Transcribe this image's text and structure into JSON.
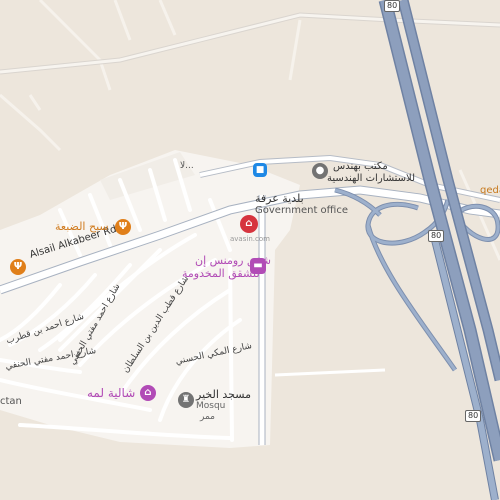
{
  "roads": {
    "alsail": "Alsail Alkabeer Rd",
    "street_1": "شارع احمد بن قطرب",
    "street_2": "شارع احمد مفتي الحنفي",
    "street_3": "شارع احمد مفتي الحنفي",
    "street_4": "شارع المكي الحسني",
    "street_5": "شارع قطب الدين بن السلطان",
    "street_top": "لا...",
    "left_edge": "ctan",
    "qeda": "qeda",
    "shield_80_a": "80",
    "shield_80_b": "80",
    "shield_80_c": "80",
    "ghost_label": "avasin.com"
  },
  "pois": {
    "sabaa": {
      "name": "سبح الضبعة",
      "icon": "restaurant-icon"
    },
    "left_food": {
      "icon": "restaurant-icon"
    },
    "office": {
      "name_ar": "مكتب بهندس",
      "name_ar2": "للاستشارات الهندسية",
      "icon": "place-icon"
    },
    "municipality": {
      "name_ar": "بلدية عرفة",
      "name_en": "Government office",
      "icon": "government-icon"
    },
    "rooms": {
      "name_ar": "شقق رومنس إن",
      "name_ar2": "للشقق المخدومة",
      "icon": "hotel-icon"
    },
    "shalia": {
      "name": "شالية لمه",
      "icon": "shopping-icon"
    },
    "mosque": {
      "name_ar": "مسجد الخير",
      "name_en": "Mosqu",
      "name_ar2": "ممر",
      "icon": "mosque-icon"
    },
    "lock": {
      "icon": "lock-icon"
    }
  },
  "colors": {
    "land": "#ede6dc",
    "residential": "#f7f4f0",
    "street": "#ffffff",
    "highway": "#8d9fbd",
    "highway_edge": "#6f82a3",
    "food": "#e07f1a",
    "shop": "#b14bb6",
    "gov": "#d6343e",
    "place": "#737373",
    "blue": "#1e88e5"
  }
}
